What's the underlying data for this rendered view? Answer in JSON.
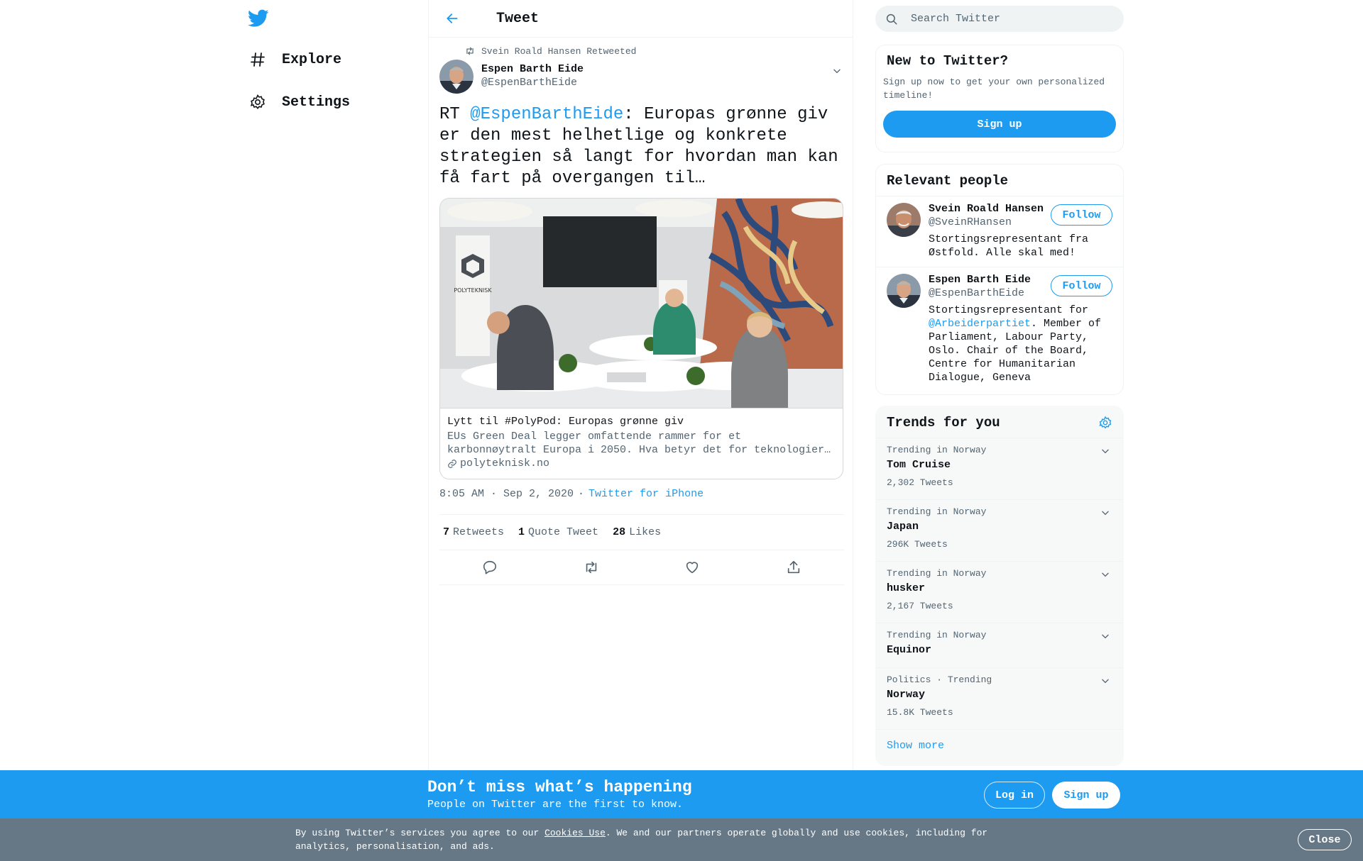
{
  "colors": {
    "accent": "#1d9bf0",
    "text": "#0f1419",
    "secondary": "#536471",
    "cookie_bar": "#667786"
  },
  "nav": {
    "logo_icon": "twitter-bird-icon",
    "items": [
      {
        "label": "Explore",
        "icon": "hashtag-icon"
      },
      {
        "label": "Settings",
        "icon": "gear-icon"
      }
    ]
  },
  "header": {
    "title": "Tweet",
    "back_icon": "arrow-left-icon"
  },
  "tweet": {
    "retweeted_by": "Svein Roald Hansen Retweeted",
    "author": {
      "name": "Espen Barth Eide",
      "handle": "@EspenBarthEide"
    },
    "text_prefix": "RT ",
    "mention": "@EspenBarthEide",
    "text_rest": ": Europas grønne giv er den mest helhetlige og konkrete strategien så langt for hvordan man kan få fart på overgangen til…",
    "card": {
      "title": "Lytt til #PolyPod: Europas grønne giv",
      "description_line1": "EUs Green Deal legger omfattende rammer for et",
      "description_line2": "karbonnøytralt Europa i 2050. Hva betyr det for teknologier…",
      "domain": "polyteknisk.no",
      "photo_banner_text": "POLYTEKNISK"
    },
    "timestamp": "8:05 AM · Sep 2, 2020",
    "source_sep": "·",
    "source": "Twitter for iPhone",
    "stats": [
      {
        "count": "7",
        "label": "Retweets"
      },
      {
        "count": "1",
        "label": "Quote Tweet"
      },
      {
        "count": "28",
        "label": "Likes"
      }
    ]
  },
  "search": {
    "placeholder": "Search Twitter"
  },
  "new_to_twitter": {
    "title": "New to Twitter?",
    "text": "Sign up now to get your own personalized timeline!",
    "button": "Sign up"
  },
  "relevant_people": {
    "title": "Relevant people",
    "people": [
      {
        "name": "Svein Roald Hansen",
        "handle": "@SveinRHansen",
        "bio": "Stortingsrepresentant fra Østfold. Alle skal med!",
        "follow": "Follow"
      },
      {
        "name": "Espen Barth Eide",
        "handle": "@EspenBarthEide",
        "bio_prefix": "Stortingsrepresentant for ",
        "bio_mention": "@Arbeiderpartiet",
        "bio_rest": ". Member of Parliament, Labour Party, Oslo. Chair of the Board, Centre for Humanitarian Dialogue, Geneva",
        "follow": "Follow"
      }
    ]
  },
  "trends": {
    "title": "Trends for you",
    "items": [
      {
        "context": "Trending in Norway",
        "name": "Tom Cruise",
        "count": "2,302 Tweets"
      },
      {
        "context": "Trending in Norway",
        "name": "Japan",
        "count": "296K Tweets"
      },
      {
        "context": "Trending in Norway",
        "name": "husker",
        "count": "2,167 Tweets"
      },
      {
        "context": "Trending in Norway",
        "name": "Equinor"
      },
      {
        "context": "Politics · Trending",
        "name": "Norway",
        "count": "15.8K Tweets"
      }
    ],
    "show_more": "Show more"
  },
  "banner": {
    "title": "Don’t miss what’s happening",
    "subtitle": "People on Twitter are the first to know.",
    "login": "Log in",
    "signup": "Sign up"
  },
  "cookies": {
    "text_before": "By using Twitter’s services you agree to our ",
    "link": "Cookies Use",
    "text_after": ". We and our partners operate globally and use cookies, including for analytics, personalisation, and ads.",
    "close": "Close"
  }
}
